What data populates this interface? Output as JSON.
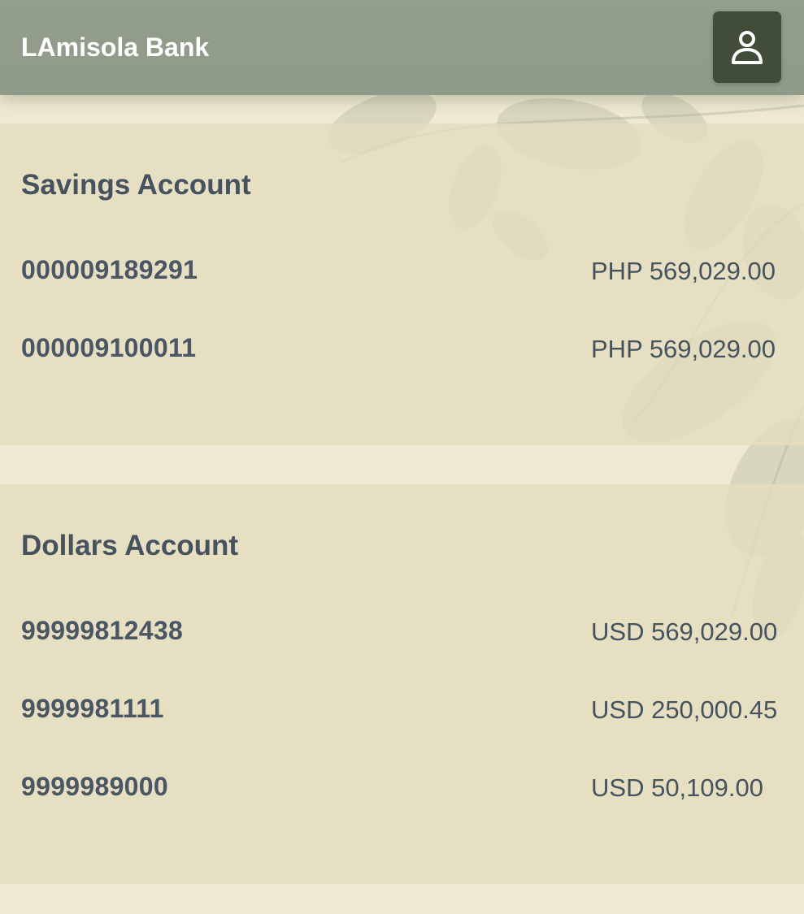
{
  "app": {
    "title": "LAmisola Bank"
  },
  "header": {
    "profile_icon": "user-icon"
  },
  "sections": [
    {
      "title": "Savings Account",
      "accounts": [
        {
          "number": "000009189291",
          "currency": "PHP",
          "amount": "569,029.00"
        },
        {
          "number": "000009100011",
          "currency": "PHP",
          "amount": "569,029.00"
        }
      ]
    },
    {
      "title": "Dollars Account",
      "accounts": [
        {
          "number": "99999812438",
          "currency": "USD",
          "amount": "569,029.00"
        },
        {
          "number": "9999981111",
          "currency": "USD",
          "amount": "250,000.45"
        },
        {
          "number": "9999989000",
          "currency": "USD",
          "amount": "50,109.00"
        }
      ]
    }
  ],
  "colors": {
    "header": "#939e8c",
    "profile_button": "#414d39",
    "page_bg": "#efe9d2",
    "text": "#46525e"
  }
}
